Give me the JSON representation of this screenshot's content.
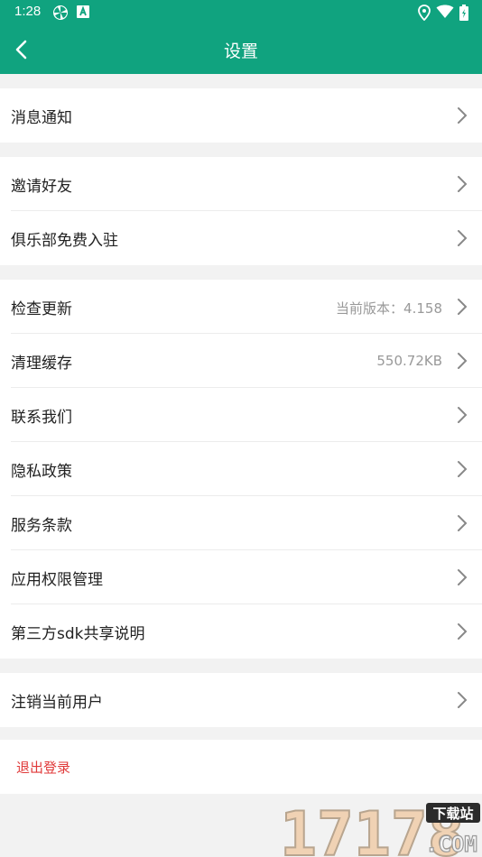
{
  "status_bar": {
    "time": "1:28",
    "icons": [
      "pinwheel-icon",
      "app-a-icon",
      "location-icon",
      "wifi-icon",
      "battery-icon"
    ]
  },
  "header": {
    "title": "设置",
    "back_icon": "chevron-left-icon"
  },
  "groups": [
    {
      "items": [
        {
          "label": "消息通知",
          "value": ""
        }
      ]
    },
    {
      "items": [
        {
          "label": "邀请好友",
          "value": ""
        },
        {
          "label": "俱乐部免费入驻",
          "value": ""
        }
      ]
    },
    {
      "items": [
        {
          "label": "检查更新",
          "value": "当前版本：4.158"
        },
        {
          "label": "清理缓存",
          "value": "550.72KB"
        },
        {
          "label": "联系我们",
          "value": ""
        },
        {
          "label": "隐私政策",
          "value": ""
        },
        {
          "label": "服务条款",
          "value": ""
        },
        {
          "label": "应用权限管理",
          "value": ""
        },
        {
          "label": "第三方sdk共享说明",
          "value": ""
        }
      ]
    },
    {
      "items": [
        {
          "label": "注销当前用户",
          "value": ""
        }
      ]
    }
  ],
  "logout": {
    "label": "退出登录"
  },
  "watermark": {
    "text": "17178",
    "badge": "下载站",
    "suffix": ".COM"
  },
  "colors": {
    "primary": "#10a37f",
    "danger": "#e03a3a",
    "background": "#f2f2f2"
  }
}
